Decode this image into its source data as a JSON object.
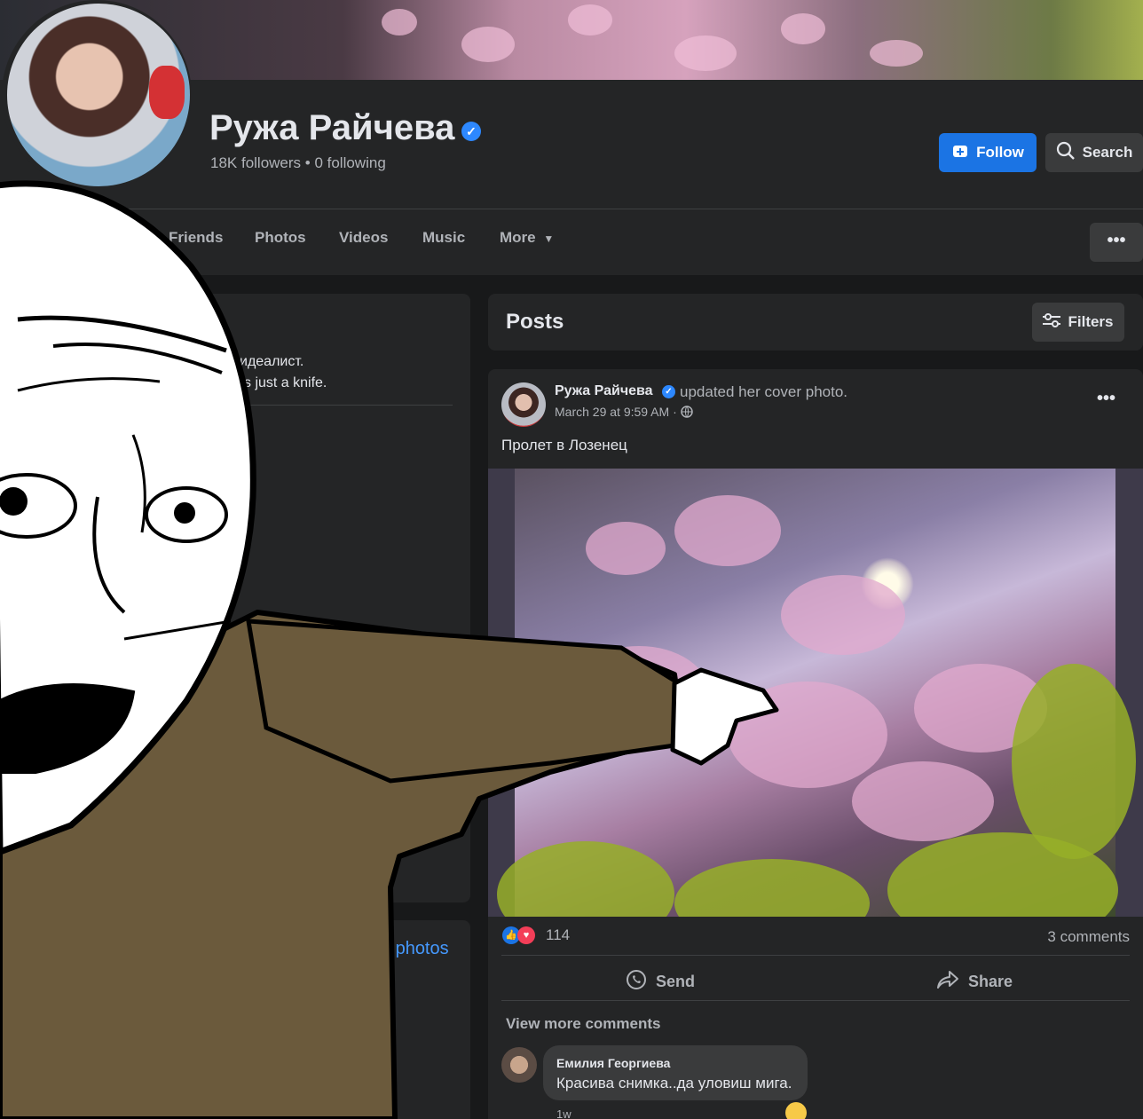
{
  "profile": {
    "name": "Ружа Райчева",
    "followers": "18K followers • 0 following",
    "follow_label": "Follow",
    "search_label": "Search"
  },
  "nav": {
    "tabs": [
      "Friends",
      "Photos",
      "Videos",
      "Music",
      "More"
    ],
    "more_dots": "•••"
  },
  "intro": {
    "line1": "идеалист.",
    "line2": "s just a knife.",
    "see_all_photos": "all photos"
  },
  "posts": {
    "title": "Posts",
    "filters_label": "Filters"
  },
  "post": {
    "author": "Ружа Райчева",
    "action": "updated her cover photo.",
    "time": "March 29 at 9:59 AM ·",
    "text": "Пролет в Лозенец",
    "reaction_count": "114",
    "comments_count": "3 comments",
    "send_label": "Send",
    "share_label": "Share",
    "view_more_comments": "View more comments",
    "dots": "•••"
  },
  "comment": {
    "author": "Емилия Георгиева",
    "text": "Красива снимка..да уловиш мига.",
    "time": "1w"
  },
  "colors": {
    "accent": "#1b74e4",
    "background": "#18191a",
    "card": "#242526",
    "verified": "#2d88ff"
  }
}
